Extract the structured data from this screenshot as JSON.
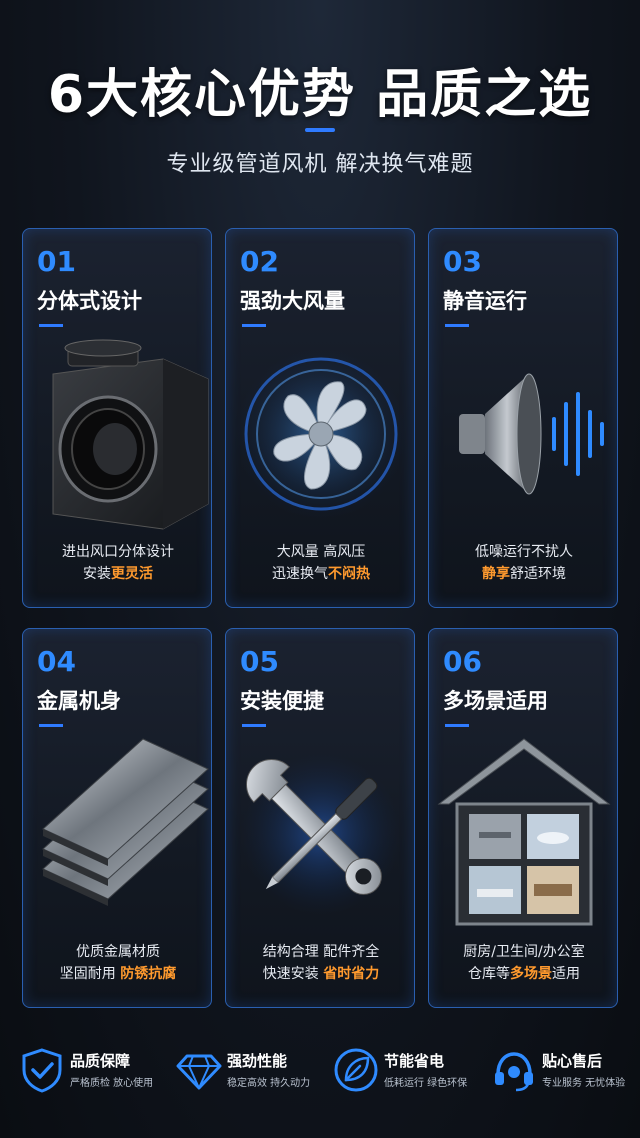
{
  "header": {
    "title": "6大核心优势  品质之选",
    "subtitle": "专业级管道风机 解决换气难题"
  },
  "cards": [
    {
      "num": "01",
      "title": "分体式设计",
      "line1": "进出风口分体设计",
      "line2_pre": "安装",
      "line2_hl": "更灵活",
      "line2_post": ""
    },
    {
      "num": "02",
      "title": "强劲大风量",
      "line1": "大风量 高风压",
      "line2_pre": "迅速换气",
      "line2_hl": "不闷热",
      "line2_post": ""
    },
    {
      "num": "03",
      "title": "静音运行",
      "line1": "低噪运行不扰人",
      "line2_pre": "",
      "line2_hl": "静享",
      "line2_post": "舒适环境"
    },
    {
      "num": "04",
      "title": "金属机身",
      "line1": "优质金属材质",
      "line2_pre": "坚固耐用 ",
      "line2_hl": "防锈抗腐",
      "line2_post": ""
    },
    {
      "num": "05",
      "title": "安装便捷",
      "line1": "结构合理 配件齐全",
      "line2_pre": "快速安装 ",
      "line2_hl": "省时省力",
      "line2_post": ""
    },
    {
      "num": "06",
      "title": "多场景适用",
      "line1": "厨房/卫生间/办公室",
      "line2_pre": "仓库等",
      "line2_hl": "多场景",
      "line2_post": "适用"
    }
  ],
  "features": [
    {
      "name": "品质保障",
      "sub": "严格质检 放心使用",
      "icon": "shield-check-icon"
    },
    {
      "name": "强劲性能",
      "sub": "稳定高效 持久动力",
      "icon": "diamond-icon"
    },
    {
      "name": "节能省电",
      "sub": "低耗运行 绿色环保",
      "icon": "leaf-icon"
    },
    {
      "name": "贴心售后",
      "sub": "专业服务 无忧体验",
      "icon": "headset-icon"
    }
  ],
  "colors": {
    "accent": "#2f7bff",
    "highlight": "#ff9a2e",
    "background": "#10151e"
  }
}
